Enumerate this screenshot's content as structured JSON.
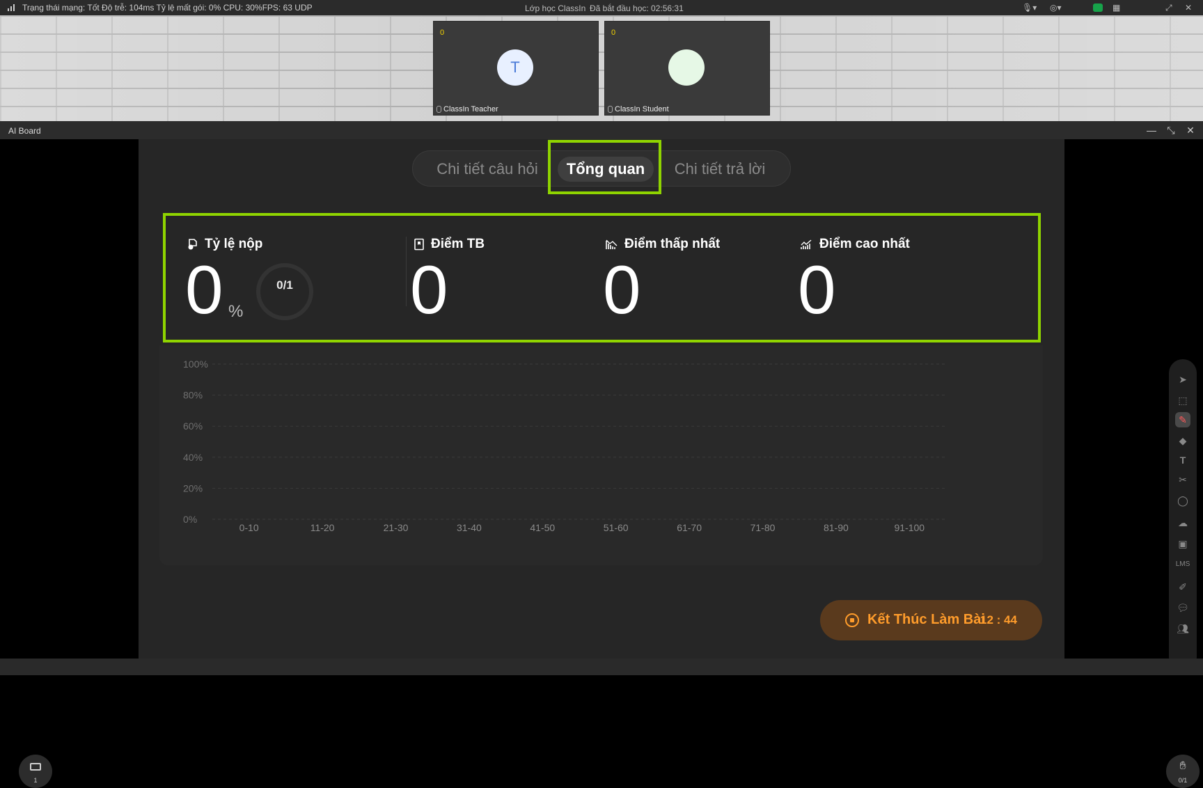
{
  "statusbar": {
    "network_status": "Trạng thái mạng: Tốt Độ trễ: 104ms Tỷ lệ mất gói: 0%  CPU: 30%FPS: 63 UDP",
    "room_title": "Lớp học ClassIn",
    "elapsed": "Đã bắt đầu học: 02:56:31"
  },
  "video": {
    "tiles": [
      {
        "count": "0",
        "avatar_letter": "T",
        "name": "ClassIn Teacher",
        "avatar_color": "#e8f0ff"
      },
      {
        "count": "0",
        "avatar_letter": "",
        "name": "ClassIn Student",
        "avatar_color": "#e6f8e6"
      }
    ]
  },
  "board": {
    "title": "AI Board"
  },
  "tabs": {
    "question_detail": "Chi tiết câu hỏi",
    "overview": "Tổng quan",
    "answer_detail": "Chi tiết trả lời"
  },
  "stats": {
    "submission_rate_label": "Tỷ lệ nộp",
    "submission_rate_value": "0",
    "submission_rate_unit": "%",
    "submitted_ratio": "0/1",
    "submission_fraction": 0,
    "avg_label": "Điểm TB",
    "avg_value": "0",
    "min_label": "Điểm thấp nhất",
    "min_value": "0",
    "max_label": "Điểm cao nhất",
    "max_value": "0"
  },
  "chart_data": {
    "type": "bar",
    "categories": [
      "0-10",
      "11-20",
      "21-30",
      "31-40",
      "41-50",
      "51-60",
      "61-70",
      "71-80",
      "81-90",
      "91-100"
    ],
    "values": [
      0,
      0,
      0,
      0,
      0,
      0,
      0,
      0,
      0,
      0
    ],
    "yticks": [
      "100%",
      "80%",
      "60%",
      "40%",
      "20%",
      "0%"
    ],
    "ylim": [
      0,
      100
    ],
    "grid": true
  },
  "end_button": {
    "label": "Kết Thúc Làm Bài",
    "timer": "12 : 44"
  },
  "controls": {
    "page_number": "1",
    "hand_count": "0/1"
  },
  "colors": {
    "highlight": "#8fd400",
    "accent_orange": "#ff9c2b"
  }
}
